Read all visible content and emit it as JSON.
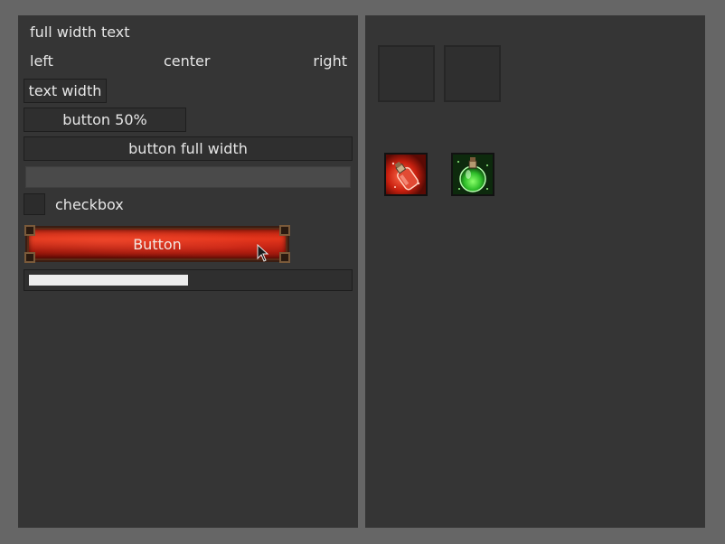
{
  "left_panel": {
    "full_width_text": "full width text",
    "align_row": {
      "left": "left",
      "center": "center",
      "right": "right"
    },
    "text_width_label": "text width",
    "button_half_label": "button 50%",
    "button_full_label": "button full width",
    "text_input_value": "",
    "checkbox": {
      "label": "checkbox",
      "checked": false
    },
    "red_button_label": "Button",
    "progress_fraction": 0.5
  },
  "right_panel": {
    "slots": [
      "empty",
      "empty"
    ],
    "items": [
      {
        "icon": "red-potion-icon",
        "color": "#d22a1e"
      },
      {
        "icon": "green-potion-icon",
        "color": "#2fbf2a"
      }
    ]
  },
  "colors": {
    "background": "#666666",
    "panel": "#353535",
    "button_red": "#c92712",
    "progress_fill": "#ececec"
  }
}
